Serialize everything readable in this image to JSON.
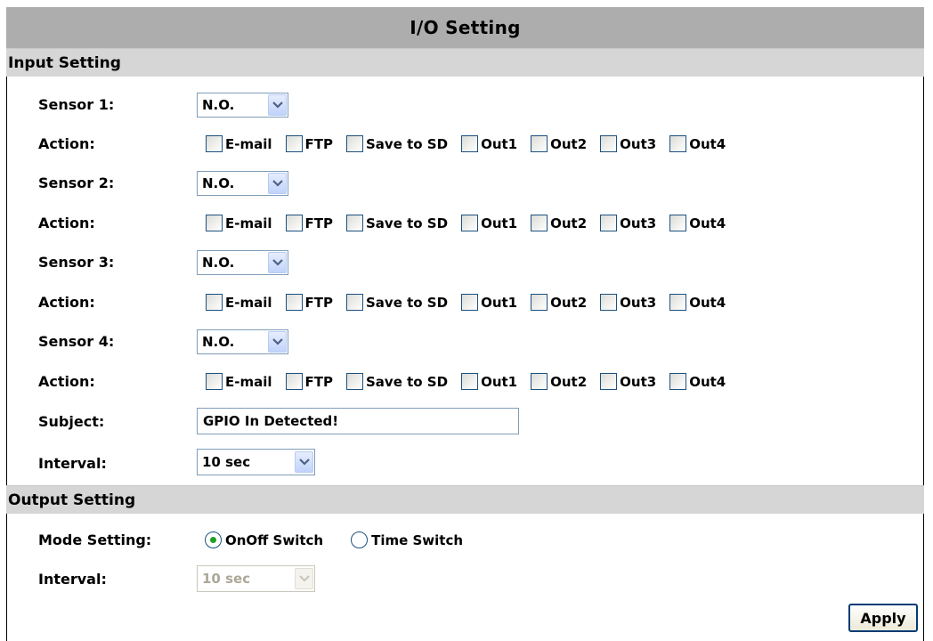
{
  "title": "I/O Setting",
  "input_setting": {
    "header": "Input Setting",
    "sensors": [
      {
        "label": "Sensor 1:",
        "mode": "N.O.",
        "action_label": "Action:"
      },
      {
        "label": "Sensor 2:",
        "mode": "N.O.",
        "action_label": "Action:"
      },
      {
        "label": "Sensor 3:",
        "mode": "N.O.",
        "action_label": "Action:"
      },
      {
        "label": "Sensor 4:",
        "mode": "N.O.",
        "action_label": "Action:"
      }
    ],
    "actions": [
      "E-mail",
      "FTP",
      "Save to SD",
      "Out1",
      "Out2",
      "Out3",
      "Out4"
    ],
    "subject_label": "Subject:",
    "subject_value": "GPIO In Detected!",
    "interval_label": "Interval:",
    "interval_value": "10 sec"
  },
  "output_setting": {
    "header": "Output Setting",
    "mode_label": "Mode Setting:",
    "mode_options": [
      "OnOff Switch",
      "Time Switch"
    ],
    "mode_selected": "OnOff Switch",
    "interval_label": "Interval:",
    "interval_value": "10 sec"
  },
  "apply_label": "Apply",
  "colors": {
    "title_bar": "#adadad",
    "section_bar": "#d6d6d6",
    "radio_dot": "#21a121",
    "control_border": "#7f9db9"
  }
}
